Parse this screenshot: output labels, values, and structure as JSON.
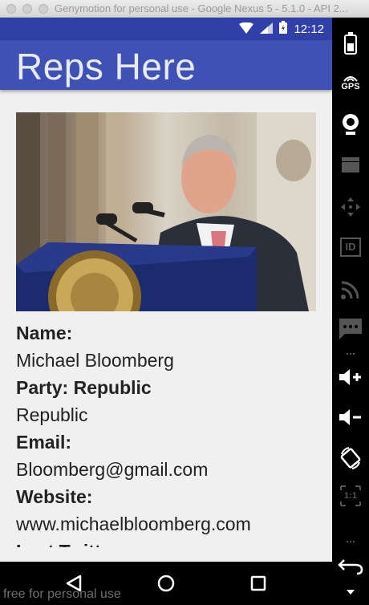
{
  "window": {
    "title": "Genymotion for personal use - Google Nexus 5 - 5.1.0 - API 2..."
  },
  "status_bar": {
    "time": "12:12"
  },
  "app_bar": {
    "title": "Reps Here"
  },
  "rep": {
    "photo_icon": "representative-photo",
    "name_label": "Name:",
    "name": "Michael Bloomberg",
    "party_label": "Party: Republic",
    "party": "Republic",
    "email_label": "Email:",
    "email": "Bloomberg@gmail.com",
    "website_label": "Website:",
    "website": "www.michaelbloomberg.com",
    "twitter_label": "Last Twitter:"
  },
  "watermark": "free for personal use",
  "toolbar": {
    "gps_label": "GPS",
    "id_label": "ID",
    "ratio_label": "1:1",
    "icons": [
      "battery-icon",
      "gps-icon",
      "webcam-icon",
      "clapperboard-icon",
      "dpad-icon",
      "id-icon",
      "rss-icon",
      "sms-icon",
      "volume-up-icon",
      "volume-down-icon",
      "rotate-icon",
      "pixel-ratio-icon",
      "back-icon",
      "menu-icon"
    ]
  },
  "nav": {
    "icons": [
      "back-triangle-icon",
      "home-circle-icon",
      "recents-square-icon"
    ]
  }
}
